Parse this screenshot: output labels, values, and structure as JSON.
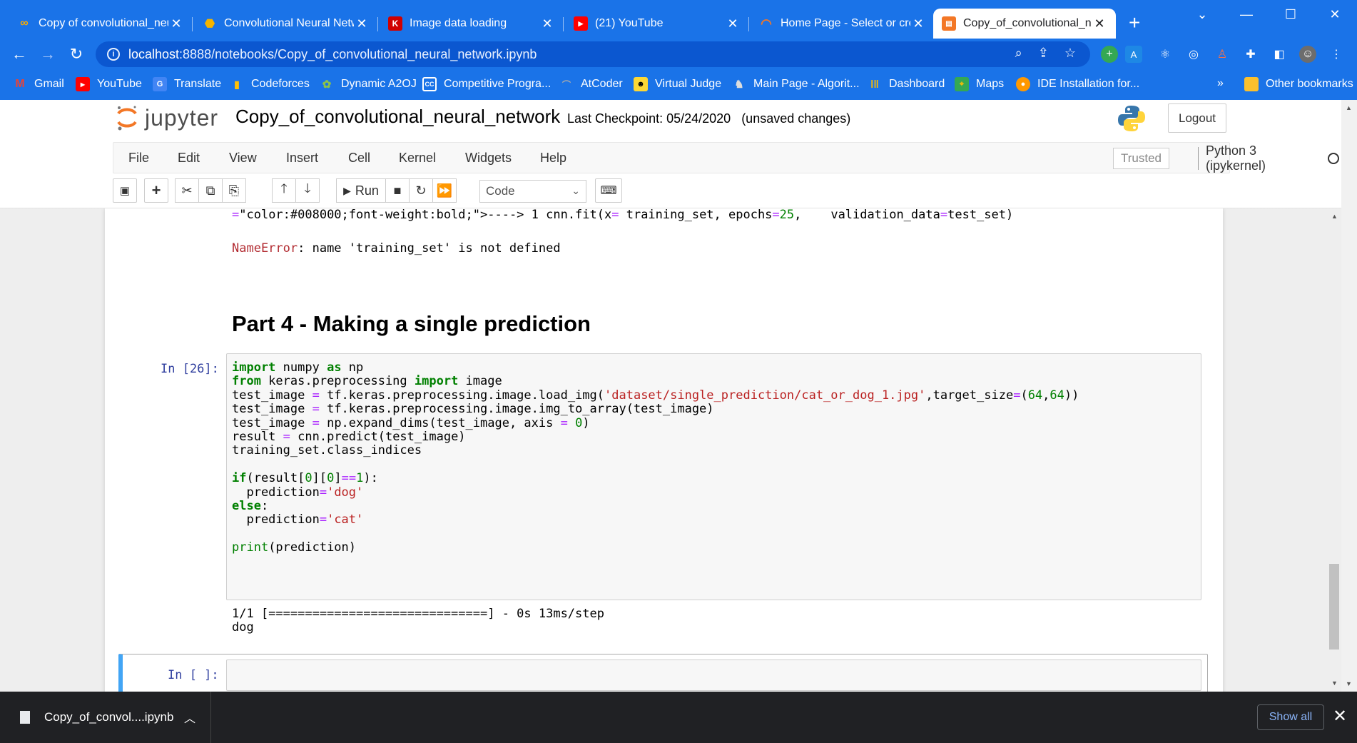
{
  "browser": {
    "tabs": [
      {
        "label": "Copy of convolutional_neu",
        "icon": "colab-icon"
      },
      {
        "label": "Convolutional Neural Netw",
        "icon": "udemy-icon"
      },
      {
        "label": "Image data loading",
        "icon": "keras-icon"
      },
      {
        "label": "(21) YouTube",
        "icon": "youtube-icon"
      },
      {
        "label": "Home Page - Select or crea",
        "icon": "jupyter-icon"
      },
      {
        "label": "Copy_of_convolutional_neu",
        "icon": "notebook-icon",
        "active": true
      }
    ],
    "url": {
      "host": "localhost",
      "rest": ":8888/notebooks/Copy_of_convolutional_neural_network.ipynb"
    },
    "bookmarks": [
      {
        "label": "Gmail"
      },
      {
        "label": "YouTube"
      },
      {
        "label": "Translate"
      },
      {
        "label": "Codeforces"
      },
      {
        "label": "Dynamic A2OJ"
      },
      {
        "label": "Competitive Progra..."
      },
      {
        "label": "AtCoder"
      },
      {
        "label": "Virtual Judge"
      },
      {
        "label": "Main Page - Algorit..."
      },
      {
        "label": "Dashboard"
      },
      {
        "label": "Maps"
      },
      {
        "label": "IDE Installation for..."
      }
    ],
    "bookmarks_overflow": "»",
    "other_bookmarks": "Other bookmarks"
  },
  "jupyter": {
    "logo_text": "jupyter",
    "notebook_name": "Copy_of_convolutional_neural_network",
    "checkpoint": "Last Checkpoint: 05/24/2020",
    "status": "(unsaved changes)",
    "logout": "Logout",
    "menu": [
      "File",
      "Edit",
      "View",
      "Insert",
      "Cell",
      "Kernel",
      "Widgets",
      "Help"
    ],
    "trusted": "Trusted",
    "kernel": "Python 3 (ipykernel)",
    "toolbar": {
      "run": "Run",
      "cell_type": "Code"
    }
  },
  "notebook": {
    "error_trace": "----> 1 cnn.fit(x= training_set, epochs=25,    validation_data=test_set)",
    "error_name": "NameError",
    "error_msg": ": name 'training_set' is not defined",
    "heading": "Part 4 - Making a single prediction",
    "cell_prompt": "In [26]:",
    "code_lines": [
      "import numpy as np",
      "from keras.preprocessing import image",
      "test_image = tf.keras.preprocessing.image.load_img('dataset/single_prediction/cat_or_dog_1.jpg',target_size=(64,64))",
      "test_image = tf.keras.preprocessing.image.img_to_array(test_image)",
      "test_image = np.expand_dims(test_image, axis = 0)",
      "result = cnn.predict(test_image)",
      "training_set.class_indices",
      "",
      "if(result[0][0]==1):",
      "  prediction='dog'",
      "else:",
      "  prediction='cat'",
      "",
      "print(prediction)"
    ],
    "output_lines": [
      "1/1 [==============================] - 0s 13ms/step",
      "dog"
    ],
    "empty_prompt": "In [ ]:"
  },
  "downloads": {
    "file": "Copy_of_convol....ipynb",
    "show_all": "Show all"
  }
}
